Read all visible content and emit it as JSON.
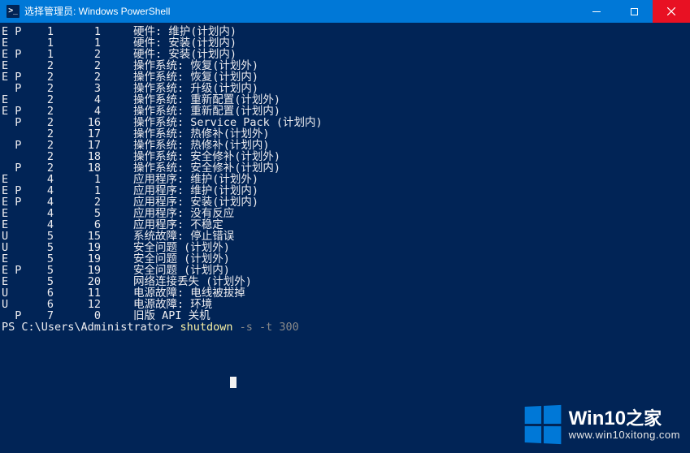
{
  "window": {
    "title": "选择管理员: Windows PowerShell"
  },
  "rows": [
    {
      "flags": "E P",
      "a": "1",
      "b": "1",
      "cat": "硬件:",
      "desc": "维护(计划内)"
    },
    {
      "flags": "E",
      "a": "1",
      "b": "1",
      "cat": "硬件:",
      "desc": "安装(计划内)"
    },
    {
      "flags": "E P",
      "a": "1",
      "b": "2",
      "cat": "硬件:",
      "desc": "安装(计划内)"
    },
    {
      "flags": "E",
      "a": "2",
      "b": "2",
      "cat": "操作系统:",
      "desc": "恢复(计划外)"
    },
    {
      "flags": "E P",
      "a": "2",
      "b": "2",
      "cat": "操作系统:",
      "desc": "恢复(计划内)"
    },
    {
      "flags": "  P",
      "a": "2",
      "b": "3",
      "cat": "操作系统:",
      "desc": "升级(计划内)"
    },
    {
      "flags": "E",
      "a": "2",
      "b": "4",
      "cat": "操作系统:",
      "desc": "重新配置(计划外)"
    },
    {
      "flags": "E P",
      "a": "2",
      "b": "4",
      "cat": "操作系统:",
      "desc": "重新配置(计划内)"
    },
    {
      "flags": "  P",
      "a": "2",
      "b": "16",
      "cat": "操作系统:",
      "desc": "Service Pack (计划内)"
    },
    {
      "flags": "",
      "a": "2",
      "b": "17",
      "cat": "操作系统:",
      "desc": "热修补(计划外)"
    },
    {
      "flags": "  P",
      "a": "2",
      "b": "17",
      "cat": "操作系统:",
      "desc": "热修补(计划内)"
    },
    {
      "flags": "",
      "a": "2",
      "b": "18",
      "cat": "操作系统:",
      "desc": "安全修补(计划外)"
    },
    {
      "flags": "  P",
      "a": "2",
      "b": "18",
      "cat": "操作系统:",
      "desc": "安全修补(计划内)"
    },
    {
      "flags": "E",
      "a": "4",
      "b": "1",
      "cat": "应用程序:",
      "desc": "维护(计划外)"
    },
    {
      "flags": "E P",
      "a": "4",
      "b": "1",
      "cat": "应用程序:",
      "desc": "维护(计划内)"
    },
    {
      "flags": "E P",
      "a": "4",
      "b": "2",
      "cat": "应用程序:",
      "desc": "安装(计划内)"
    },
    {
      "flags": "E",
      "a": "4",
      "b": "5",
      "cat": "应用程序:",
      "desc": "没有反应"
    },
    {
      "flags": "E",
      "a": "4",
      "b": "6",
      "cat": "应用程序:",
      "desc": "不稳定"
    },
    {
      "flags": "U",
      "a": "5",
      "b": "15",
      "cat": "系统故障:",
      "desc": "停止错误"
    },
    {
      "flags": "U",
      "a": "5",
      "b": "19",
      "cat": "安全问题",
      "desc": "(计划外)"
    },
    {
      "flags": "E",
      "a": "5",
      "b": "19",
      "cat": "安全问题",
      "desc": "(计划外)"
    },
    {
      "flags": "E P",
      "a": "5",
      "b": "19",
      "cat": "安全问题",
      "desc": "(计划内)"
    },
    {
      "flags": "E",
      "a": "5",
      "b": "20",
      "cat": "网络连接丢失",
      "desc": "(计划外)"
    },
    {
      "flags": "U",
      "a": "6",
      "b": "11",
      "cat": "电源故障:",
      "desc": "电线被拔掉"
    },
    {
      "flags": "U",
      "a": "6",
      "b": "12",
      "cat": "电源故障:",
      "desc": "环境"
    },
    {
      "flags": "  P",
      "a": "7",
      "b": "0",
      "cat": "旧版 API",
      "desc": "关机"
    }
  ],
  "prompt": {
    "path": "PS C:\\Users\\Administrator> ",
    "cmd": "shutdown",
    "args": " -s -t 300"
  },
  "watermark": {
    "line1a": "Win10",
    "line1b": "之家",
    "line2": "www.win10xitong.com"
  }
}
